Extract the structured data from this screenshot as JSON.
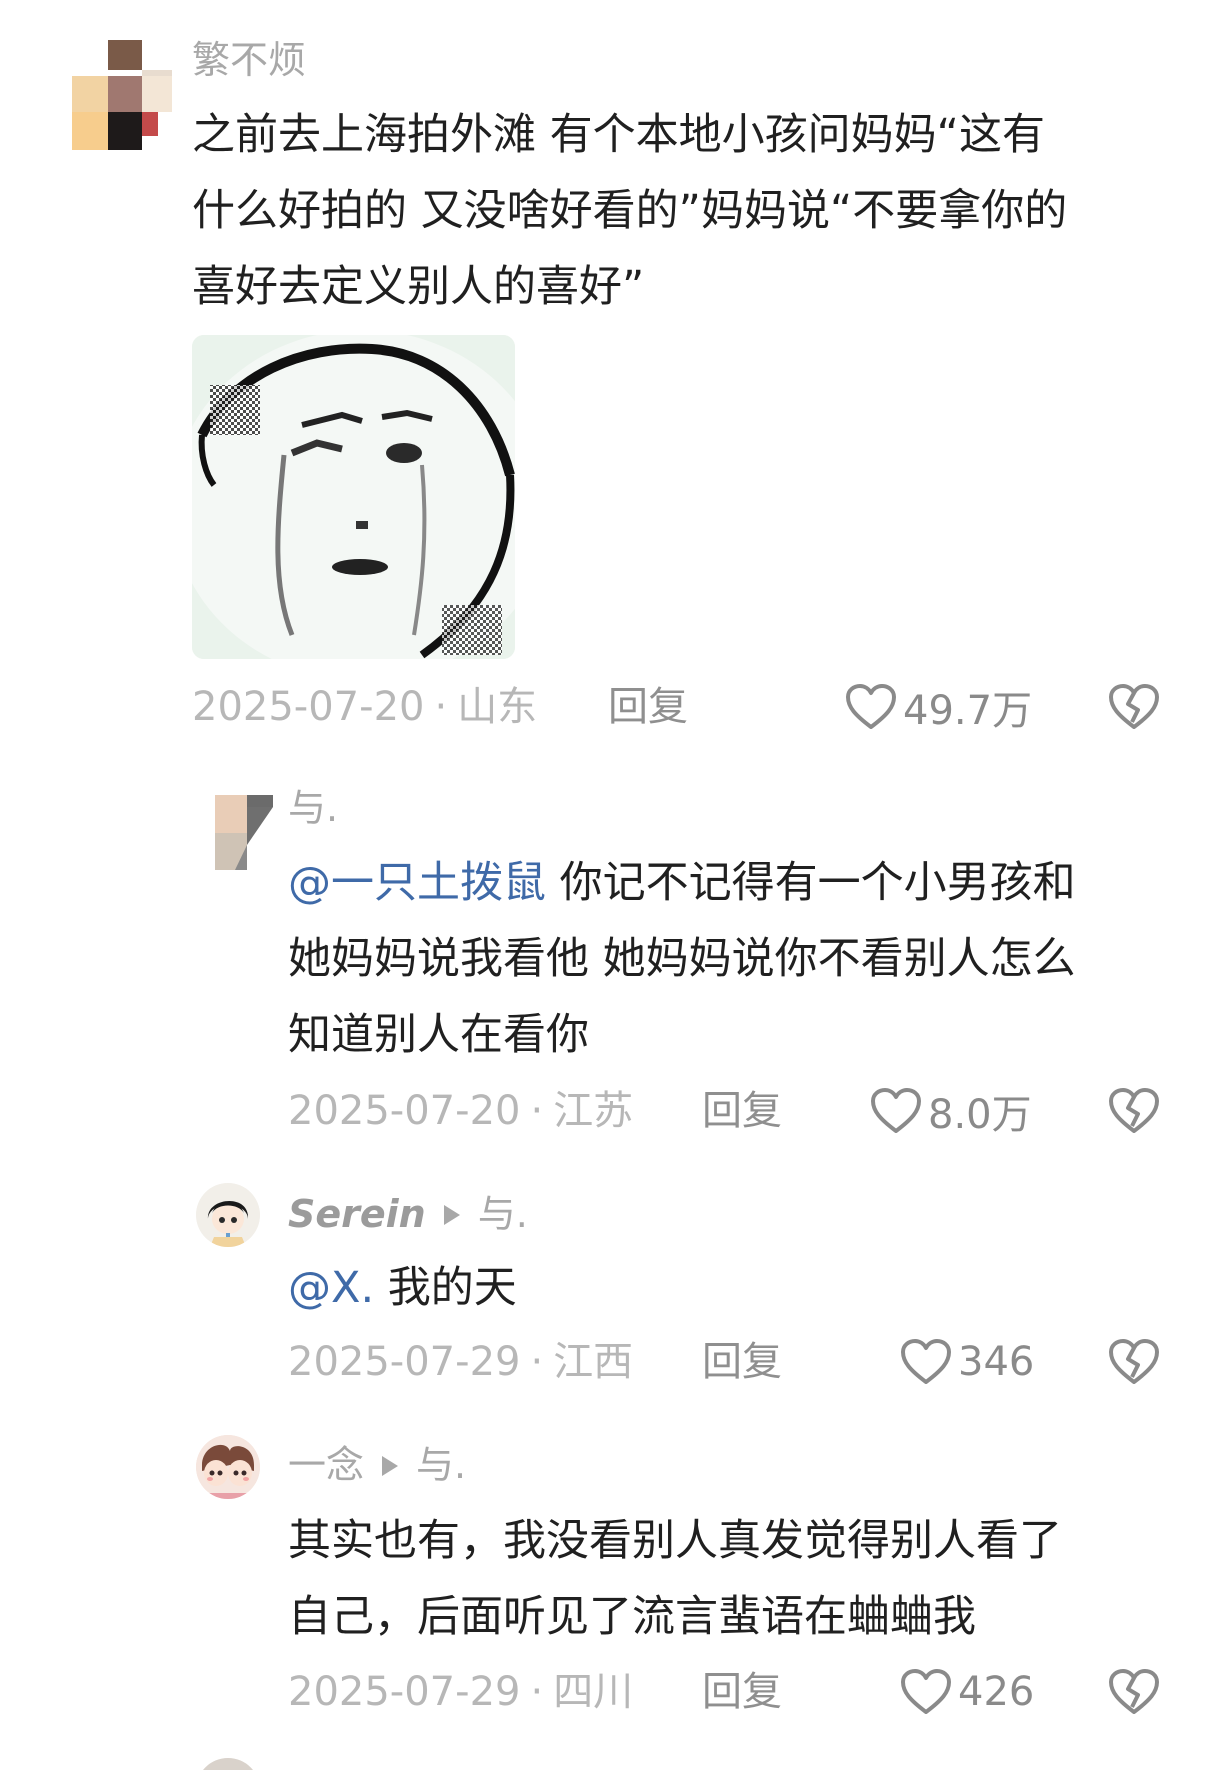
{
  "comments": [
    {
      "username": "繁不烦",
      "lines": [
        "之前去上海拍外滩 有个本地小孩问妈妈“这有",
        "什么好拍的 又没啥好看的”妈妈说“不要拿你的",
        "喜好去定义别人的喜好”"
      ],
      "date": "2025-07-20",
      "location": "山东",
      "reply_label": "回复",
      "likes": "49.7万",
      "has_sticker": true
    },
    {
      "username": "与.",
      "mention": "@一只土拨鼠",
      "lines": [
        " 你记不记得有一个小男孩和",
        "她妈妈说我看他 她妈妈说你不看别人怎么",
        "知道别人在看你"
      ],
      "date": "2025-07-20",
      "location": "江苏",
      "reply_label": "回复",
      "likes": "8.0万"
    },
    {
      "username": "Serein",
      "reply_to": "与.",
      "mention": "@X.",
      "lines": [
        " 我的天"
      ],
      "date": "2025-07-29",
      "location": "江西",
      "reply_label": "回复",
      "likes": "346"
    },
    {
      "username": "一念",
      "reply_to": "与.",
      "lines": [
        "其实也有，我没看别人真发觉得别人看了",
        "自己，后面听见了流言蜚语在蛐蛐我"
      ],
      "date": "2025-07-29",
      "location": "四川",
      "reply_label": "回复",
      "likes": "426"
    }
  ],
  "colors": {
    "text": "#202020",
    "meta": "#b7b7b7",
    "mention": "#3f6aa8",
    "icon": "#8a8a8a"
  },
  "icons": {
    "like": "heart-outline-icon",
    "dislike": "broken-heart-icon",
    "reply_arrow": "play-triangle-icon"
  }
}
